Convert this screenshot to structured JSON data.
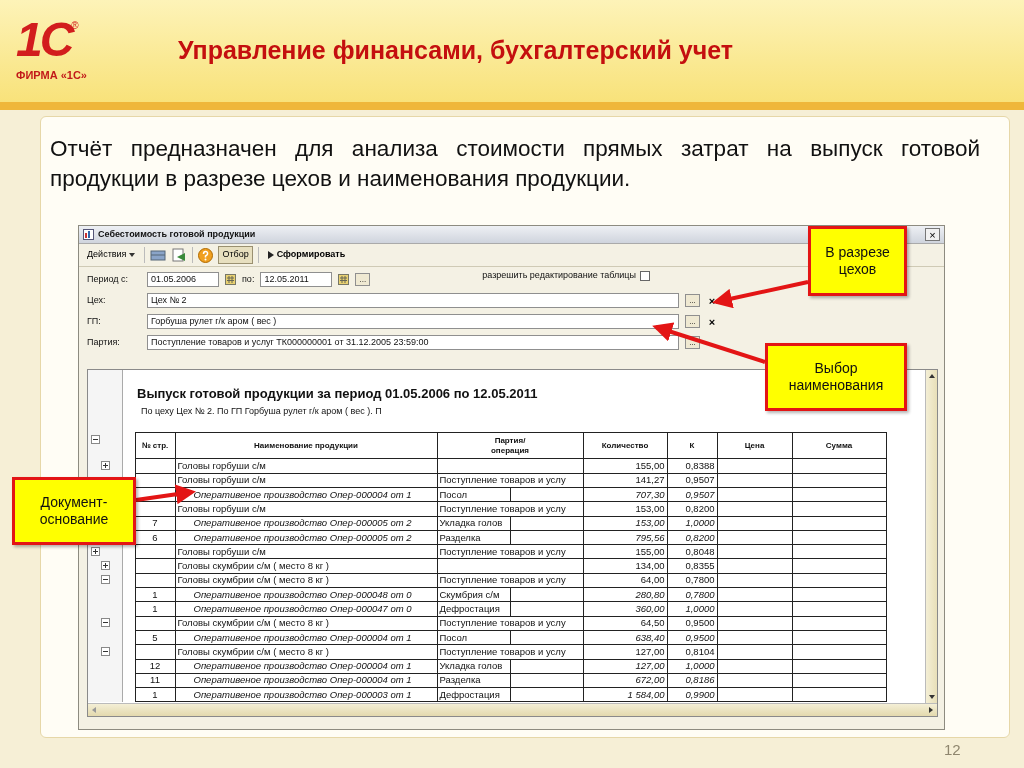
{
  "slide": {
    "logo": {
      "mark": "1С",
      "reg": "®",
      "caption": "ФИРМА «1С»"
    },
    "title": "Управление финансами, бухгалтерский учет",
    "paragraph": "Отчёт предназначен для анализа стоимости прямых затрат на выпуск готовой продукции в  разрезе цехов и наименования продукции.",
    "page_number": "12"
  },
  "window": {
    "title": "Себестоимость готовой продукции",
    "close": "×",
    "toolbar": {
      "actions_menu": "Действия",
      "filter_button": {
        "label": "Отбор",
        "pressed": true
      },
      "run_button": "Сформировать"
    },
    "period": {
      "from_label": "Период с:",
      "from": "01.05.2006",
      "to_label": "по:",
      "to": "12.05.2011",
      "more": "..."
    },
    "edit_table": {
      "label": "разрешить редактирование таблицы",
      "checked": false
    },
    "fields": [
      {
        "label": "Цех:",
        "value": "Цех № 2",
        "select": "...",
        "clear": "×"
      },
      {
        "label": "ГП:",
        "value": "Горбуша рулет г/к аром ( вес )",
        "select": "...",
        "clear": "×"
      },
      {
        "label": "Партия:",
        "value": "Поступление товаров и услуг ТК000000001 от 31.12.2005 23:59:00",
        "select": "..."
      }
    ],
    "report": {
      "title": "Выпуск готовой продукции за период 01.05.2006 по 12.05.2011",
      "subtitle": "По цеху Цех № 2. По ГП Горбуша рулет г/к аром ( вес ). П",
      "header_expanded": true,
      "columns": [
        "№ стр.",
        "Наименование продукции",
        "Партия/\nоперация",
        "Количество",
        "К",
        "Цена",
        "Сумма"
      ],
      "rows": [
        {
          "kind": "group",
          "num": "",
          "name": "Головы горбуши с/м",
          "party": "",
          "qty": "155,00",
          "k": "0,8388",
          "outer": false,
          "expanded": false
        },
        {
          "kind": "batch",
          "num": "",
          "name": "Головы горбуши с/м",
          "party": "Поступление товаров и услу",
          "qty": "141,27",
          "k": "0,9507"
        },
        {
          "kind": "operation",
          "num": "",
          "name": "Оперативеное производство Опер-000004 от 1",
          "party": "Посол",
          "qty": "707,30",
          "k": "0,9507"
        },
        {
          "kind": "batch",
          "num": "",
          "name": "Головы горбуши с/м",
          "party": "Поступление товаров и услу",
          "qty": "153,00",
          "k": "0,8200"
        },
        {
          "kind": "operation",
          "num": "7",
          "name": "Оперативеное производство Опер-000005 от 2",
          "party": "Укладка голов",
          "qty": "153,00",
          "k": "1,0000"
        },
        {
          "kind": "operation",
          "num": "6",
          "name": "Оперативеное производство Опер-000005 от 2",
          "party": "Разделка",
          "qty": "795,56",
          "k": "0,8200"
        },
        {
          "kind": "batch",
          "num": "",
          "name": "Головы горбуши с/м",
          "party": "Поступление товаров и услу",
          "qty": "155,00",
          "k": "0,8048",
          "outer": true,
          "expanded": false
        },
        {
          "kind": "group",
          "num": "",
          "name": "Головы скумбрии с/м ( место 8 кг )",
          "party": "",
          "qty": "134,00",
          "k": "0,8355",
          "outer": false,
          "expanded": false
        },
        {
          "kind": "batch",
          "num": "",
          "name": "Головы скумбрии с/м ( место 8 кг )",
          "party": "Поступление товаров и услу",
          "qty": "64,00",
          "k": "0,7800",
          "outer": false,
          "expanded": true
        },
        {
          "kind": "operation",
          "num": "1",
          "name": "Оперативеное производство Опер-000048 от 0",
          "party": "Скумбрия с/м",
          "qty": "280,80",
          "k": "0,7800"
        },
        {
          "kind": "operation",
          "num": "1",
          "name": "Оперативеное производство Опер-000047 от 0",
          "party": "Дефростация",
          "qty": "360,00",
          "k": "1,0000"
        },
        {
          "kind": "batch",
          "num": "",
          "name": "Головы скумбрии с/м ( место 8 кг )",
          "party": "Поступление товаров и услу",
          "qty": "64,50",
          "k": "0,9500",
          "outer": false,
          "expanded": true
        },
        {
          "kind": "operation",
          "num": "5",
          "name": "Оперативеное производство Опер-000004 от 1",
          "party": "Посол",
          "qty": "638,40",
          "k": "0,9500"
        },
        {
          "kind": "batch",
          "num": "",
          "name": "Головы скумбрии с/м ( место 8 кг )",
          "party": "Поступление товаров и услу",
          "qty": "127,00",
          "k": "0,8104",
          "outer": false,
          "expanded": true
        },
        {
          "kind": "operation",
          "num": "12",
          "name": "Оперативеное производство Опер-000004 от 1",
          "party": "Укладка голов",
          "qty": "127,00",
          "k": "1,0000"
        },
        {
          "kind": "operation",
          "num": "11",
          "name": "Оперативеное производство Опер-000004 от 1",
          "party": "Разделка",
          "qty": "672,00",
          "k": "0,8186"
        },
        {
          "kind": "operation",
          "num": "1",
          "name": "Оперативеное производство Опер-000003 от 1",
          "party": "Дефростация",
          "qty": "1 584,00",
          "k": "0,9900"
        }
      ]
    }
  },
  "callouts": [
    {
      "text": "В разрезе цехов"
    },
    {
      "text": "Выбор наименования"
    },
    {
      "text": "Документ-основание"
    }
  ]
}
